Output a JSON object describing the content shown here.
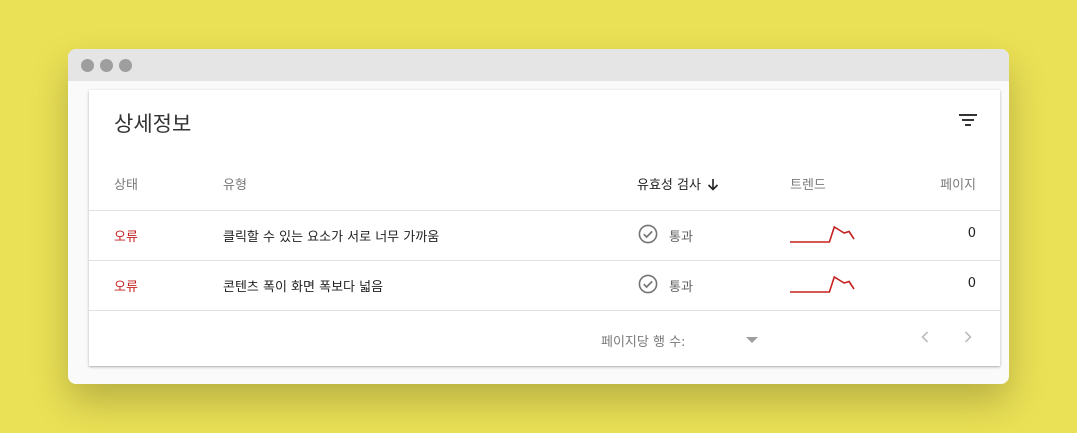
{
  "window": {
    "controls": [
      "close",
      "minimize",
      "maximize"
    ]
  },
  "card": {
    "title": "상세정보",
    "filter_icon": "filter-list-icon"
  },
  "table": {
    "headers": {
      "status": "상태",
      "type": "유형",
      "validation": "유효성 검사",
      "trend": "트렌드",
      "pages": "페이지"
    },
    "sort": {
      "column": "validation",
      "direction": "descending"
    },
    "rows": [
      {
        "status": "오류",
        "type": "클릭할 수 있는 요소가 서로 너무 가까움",
        "validation": "통과",
        "trend": [
          0,
          0,
          0,
          0,
          0,
          0,
          0,
          0,
          0,
          1,
          0.8,
          0.6,
          0.7,
          0.2
        ],
        "pages": "0"
      },
      {
        "status": "오류",
        "type": "콘텐츠 폭이 화면 폭보다 넓음",
        "validation": "통과",
        "trend": [
          0,
          0,
          0,
          0,
          0,
          0,
          0,
          0,
          0,
          1,
          0.8,
          0.6,
          0.7,
          0.2
        ],
        "pages": "0"
      }
    ]
  },
  "footer": {
    "rows_per_page_label": "페이지당 행 수:",
    "prev_icon": "chevron-left-icon",
    "next_icon": "chevron-right-icon"
  },
  "colors": {
    "background": "#ebe156",
    "error": "#c5221f",
    "trend_line": "#c5221f"
  }
}
